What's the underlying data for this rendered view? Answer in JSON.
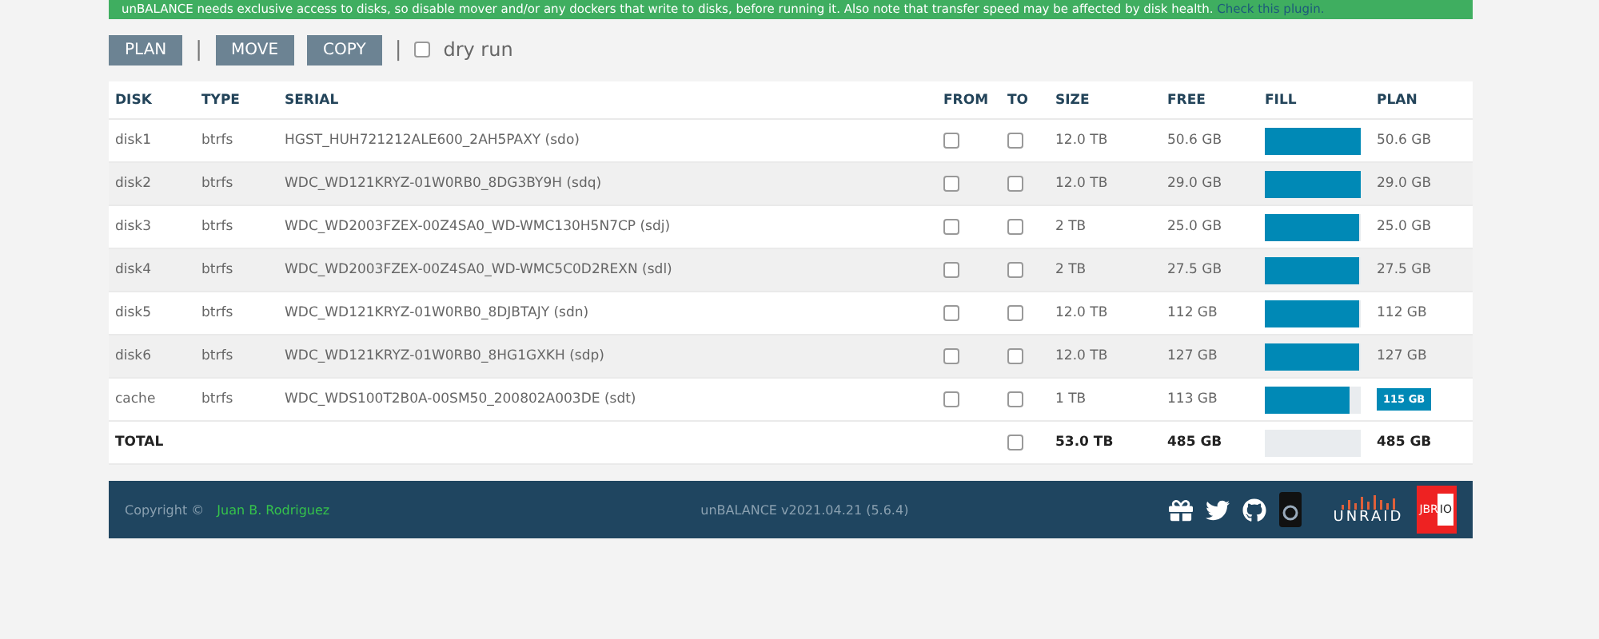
{
  "banner": {
    "text": "unBALANCE needs exclusive access to disks, so disable mover and/or any dockers that write to disks, before running it. Also note that transfer speed may be affected by disk health.",
    "link": "Check this plugin."
  },
  "toolbar": {
    "buttons": [
      "PLAN",
      "MOVE",
      "COPY"
    ],
    "separator": "|",
    "dry_run": {
      "label": "dry run",
      "checked": false
    }
  },
  "table": {
    "columns": [
      "DISK",
      "TYPE",
      "SERIAL",
      "FROM",
      "TO",
      "SIZE",
      "FREE",
      "FILL",
      "PLAN"
    ],
    "rows": [
      {
        "disk": "disk1",
        "type": "btrfs",
        "serial": "HGST_HUH721212ALE600_2AH5PAXY (sdo)",
        "from": false,
        "to": false,
        "size": "12.0 TB",
        "free": "50.6 GB",
        "level": 0.996,
        "plan": "50.6 GB",
        "plan_badge": false
      },
      {
        "disk": "disk2",
        "type": "btrfs",
        "serial": "WDC_WD121KRYZ-01W0RB0_8DG3BY9H (sdq)",
        "from": false,
        "to": false,
        "size": "12.0 TB",
        "free": "29.0 GB",
        "level": 0.998,
        "plan": "29.0 GB",
        "plan_badge": false
      },
      {
        "disk": "disk3",
        "type": "btrfs",
        "serial": "WDC_WD2003FZEX-00Z4SA0_WD-WMC130H5N7CP (sdj)",
        "from": false,
        "to": false,
        "size": "2 TB",
        "free": "25.0 GB",
        "level": 0.988,
        "plan": "25.0 GB",
        "plan_badge": false
      },
      {
        "disk": "disk4",
        "type": "btrfs",
        "serial": "WDC_WD2003FZEX-00Z4SA0_WD-WMC5C0D2REXN (sdl)",
        "from": false,
        "to": false,
        "size": "2 TB",
        "free": "27.5 GB",
        "level": 0.986,
        "plan": "27.5 GB",
        "plan_badge": false
      },
      {
        "disk": "disk5",
        "type": "btrfs",
        "serial": "WDC_WD121KRYZ-01W0RB0_8DJBTAJY (sdn)",
        "from": false,
        "to": false,
        "size": "12.0 TB",
        "free": "112 GB",
        "level": 0.99,
        "plan": "112 GB",
        "plan_badge": false
      },
      {
        "disk": "disk6",
        "type": "btrfs",
        "serial": "WDC_WD121KRYZ-01W0RB0_8HG1GXKH (sdp)",
        "from": false,
        "to": false,
        "size": "12.0 TB",
        "free": "127 GB",
        "level": 0.989,
        "plan": "127 GB",
        "plan_badge": false
      },
      {
        "disk": "cache",
        "type": "btrfs",
        "serial": "WDC_WDS100T2B0A-00SM50_200802A003DE (sdt)",
        "from": false,
        "to": false,
        "size": "1 TB",
        "free": "113 GB",
        "level": 0.887,
        "plan": "115 GB",
        "plan_badge": true
      }
    ],
    "total": {
      "label": "TOTAL",
      "to": false,
      "size": "53.0 TB",
      "free": "485 GB",
      "level": 0,
      "plan": "485 GB"
    }
  },
  "footer": {
    "copyright": "Copyright ©",
    "author": "Juan B. Rodriguez",
    "version": "unBALANCE v2021.04.21 (5.6.4)",
    "unraid": "UNRAID",
    "jbr": "JBR",
    "io": "IO"
  }
}
